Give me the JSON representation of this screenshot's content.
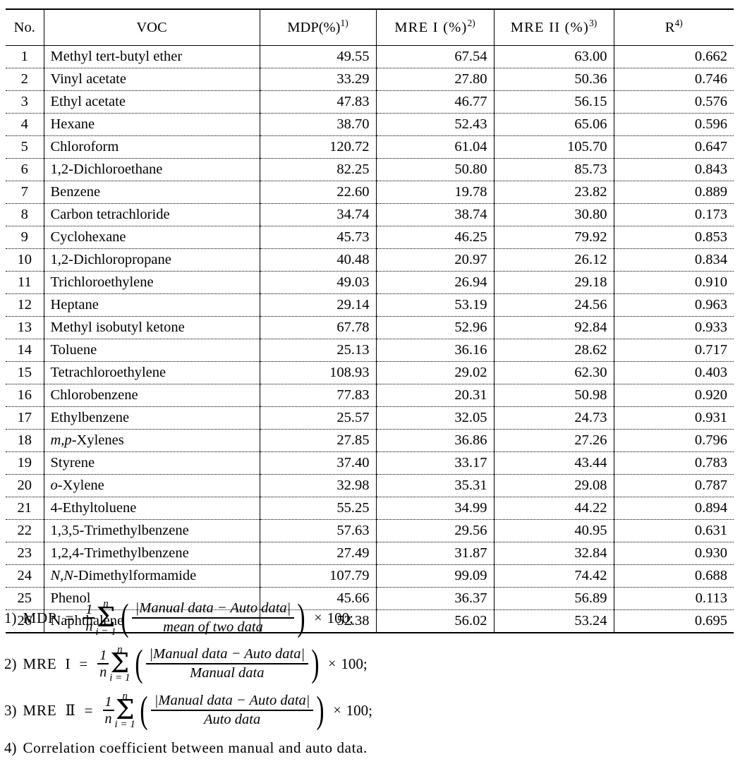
{
  "table": {
    "columns": [
      {
        "key": "no",
        "label": "No.",
        "sup": ""
      },
      {
        "key": "voc",
        "label": "VOC",
        "sup": ""
      },
      {
        "key": "mdp",
        "label": "MDP(%)",
        "sup": "1)"
      },
      {
        "key": "mre1",
        "label": "MRE  I (%)",
        "sup": "2)"
      },
      {
        "key": "mre2",
        "label": "MRE  II (%)",
        "sup": "3)"
      },
      {
        "key": "r",
        "label": "R",
        "sup": "4)"
      }
    ],
    "rows": [
      {
        "no": "1",
        "voc": "Methyl  tert-butyl  ether",
        "mdp": "49.55",
        "mre1": "67.54",
        "mre2": "63.00",
        "r": "0.662"
      },
      {
        "no": "2",
        "voc": "Vinyl  acetate",
        "mdp": "33.29",
        "mre1": "27.80",
        "mre2": "50.36",
        "r": "0.746"
      },
      {
        "no": "3",
        "voc": "Ethyl  acetate",
        "mdp": "47.83",
        "mre1": "46.77",
        "mre2": "56.15",
        "r": "0.576"
      },
      {
        "no": "4",
        "voc": "Hexane",
        "mdp": "38.70",
        "mre1": "52.43",
        "mre2": "65.06",
        "r": "0.596"
      },
      {
        "no": "5",
        "voc": "Chloroform",
        "mdp": "120.72",
        "mre1": "61.04",
        "mre2": "105.70",
        "r": "0.647"
      },
      {
        "no": "6",
        "voc": "1,2-Dichloroethane",
        "mdp": "82.25",
        "mre1": "50.80",
        "mre2": "85.73",
        "r": "0.843"
      },
      {
        "no": "7",
        "voc": "Benzene",
        "mdp": "22.60",
        "mre1": "19.78",
        "mre2": "23.82",
        "r": "0.889"
      },
      {
        "no": "8",
        "voc": "Carbon  tetrachloride",
        "mdp": "34.74",
        "mre1": "38.74",
        "mre2": "30.80",
        "r": "0.173"
      },
      {
        "no": "9",
        "voc": "Cyclohexane",
        "mdp": "45.73",
        "mre1": "46.25",
        "mre2": "79.92",
        "r": "0.853"
      },
      {
        "no": "10",
        "voc": "1,2-Dichloropropane",
        "mdp": "40.48",
        "mre1": "20.97",
        "mre2": "26.12",
        "r": "0.834"
      },
      {
        "no": "11",
        "voc": "Trichloroethylene",
        "mdp": "49.03",
        "mre1": "26.94",
        "mre2": "29.18",
        "r": "0.910"
      },
      {
        "no": "12",
        "voc": "Heptane",
        "mdp": "29.14",
        "mre1": "53.19",
        "mre2": "24.56",
        "r": "0.963"
      },
      {
        "no": "13",
        "voc": "Methyl  isobutyl  ketone",
        "mdp": "67.78",
        "mre1": "52.96",
        "mre2": "92.84",
        "r": "0.933"
      },
      {
        "no": "14",
        "voc": "Toluene",
        "mdp": "25.13",
        "mre1": "36.16",
        "mre2": "28.62",
        "r": "0.717"
      },
      {
        "no": "15",
        "voc": "Tetrachloroethylene",
        "mdp": "108.93",
        "mre1": "29.02",
        "mre2": "62.30",
        "r": "0.403"
      },
      {
        "no": "16",
        "voc": "Chlorobenzene",
        "mdp": "77.83",
        "mre1": "20.31",
        "mre2": "50.98",
        "r": "0.920"
      },
      {
        "no": "17",
        "voc": "Ethylbenzene",
        "mdp": "25.57",
        "mre1": "32.05",
        "mre2": "24.73",
        "r": "0.931"
      },
      {
        "no": "18",
        "voc": "m,p-Xylenes",
        "voc_italic_prefix": "m,p",
        "voc_rest": "-Xylenes",
        "mdp": "27.85",
        "mre1": "36.86",
        "mre2": "27.26",
        "r": "0.796"
      },
      {
        "no": "19",
        "voc": "Styrene",
        "mdp": "37.40",
        "mre1": "33.17",
        "mre2": "43.44",
        "r": "0.783"
      },
      {
        "no": "20",
        "voc": "o-Xylene",
        "voc_italic_prefix": "o",
        "voc_rest": "-Xylene",
        "mdp": "32.98",
        "mre1": "35.31",
        "mre2": "29.08",
        "r": "0.787"
      },
      {
        "no": "21",
        "voc": "4-Ethyltoluene",
        "mdp": "55.25",
        "mre1": "34.99",
        "mre2": "44.22",
        "r": "0.894"
      },
      {
        "no": "22",
        "voc": "1,3,5-Trimethylbenzene",
        "mdp": "57.63",
        "mre1": "29.56",
        "mre2": "40.95",
        "r": "0.631"
      },
      {
        "no": "23",
        "voc": "1,2,4-Trimethylbenzene",
        "mdp": "27.49",
        "mre1": "31.87",
        "mre2": "32.84",
        "r": "0.930"
      },
      {
        "no": "24",
        "voc": "N,N-Dimethylformamide",
        "voc_italic_prefix": "N,N",
        "voc_rest": "-Dimethylformamide",
        "mdp": "107.79",
        "mre1": "99.09",
        "mre2": "74.42",
        "r": "0.688"
      },
      {
        "no": "25",
        "voc": "Phenol",
        "mdp": "45.66",
        "mre1": "36.37",
        "mre2": "56.89",
        "r": "0.113"
      },
      {
        "no": "26",
        "voc": "Naphthalene",
        "mdp": "52.38",
        "mre1": "56.02",
        "mre2": "53.24",
        "r": "0.695"
      }
    ]
  },
  "footnotes": {
    "n1": {
      "marker": "1)",
      "name": "MDP",
      "eq": "=",
      "coef_top": "1",
      "coef_bot": "n",
      "sigma_top": "n",
      "sigma_bot": "i = 1",
      "frac_top": "|Manual data − Auto data|",
      "frac_bot": "mean of two data",
      "times": "×",
      "tail": "100;"
    },
    "n2": {
      "marker": "2)",
      "name": "MRE",
      "roman": "I",
      "eq": "=",
      "coef_top": "1",
      "coef_bot": "n",
      "sigma_top": "n",
      "sigma_bot": "i = 1",
      "frac_top": "|Manual data − Auto data|",
      "frac_bot": "Manual data",
      "times": "×",
      "tail": "100;"
    },
    "n3": {
      "marker": "3)",
      "name": "MRE",
      "roman": "Ⅱ",
      "eq": "=",
      "coef_top": "1",
      "coef_bot": "n",
      "sigma_top": "n",
      "sigma_bot": "i = 1",
      "frac_top": "|Manual data − Auto data|",
      "frac_bot": "Auto data",
      "times": "×",
      "tail": "100;"
    },
    "n4": {
      "marker": "4)",
      "text": "Correlation  coefficient  between  manual  and  auto  data."
    }
  },
  "colors": {
    "text": "#000000",
    "background": "#ffffff",
    "rule": "#000000"
  }
}
